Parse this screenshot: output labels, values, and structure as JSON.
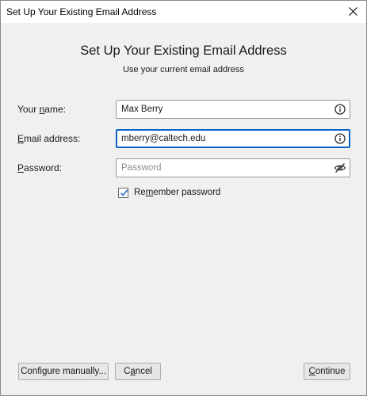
{
  "window": {
    "title": "Set Up Your Existing Email Address"
  },
  "header": {
    "title": "Set Up Your Existing Email Address",
    "subtitle": "Use your current email address"
  },
  "form": {
    "name": {
      "label_pre": "Your ",
      "label_key": "n",
      "label_post": "ame:",
      "value": "Max Berry",
      "icon": "info-icon"
    },
    "email": {
      "label_key": "E",
      "label_post": "mail address:",
      "value": "mberry@caltech.edu",
      "icon": "info-icon"
    },
    "password": {
      "label_key": "P",
      "label_post": "assword:",
      "placeholder": "Password",
      "icon": "eye-slash-icon"
    },
    "remember": {
      "checked": true,
      "label_pre": "Re",
      "label_key": "m",
      "label_post": "ember password"
    }
  },
  "buttons": {
    "configure_manually": "Configure manually...",
    "cancel_key": "a",
    "cancel_pre": "C",
    "cancel_post": "ncel",
    "continue_key": "C",
    "continue_post": "ontinue"
  },
  "colors": {
    "focus_border": "#0a62c9",
    "window_bg": "#f0f0f0"
  }
}
